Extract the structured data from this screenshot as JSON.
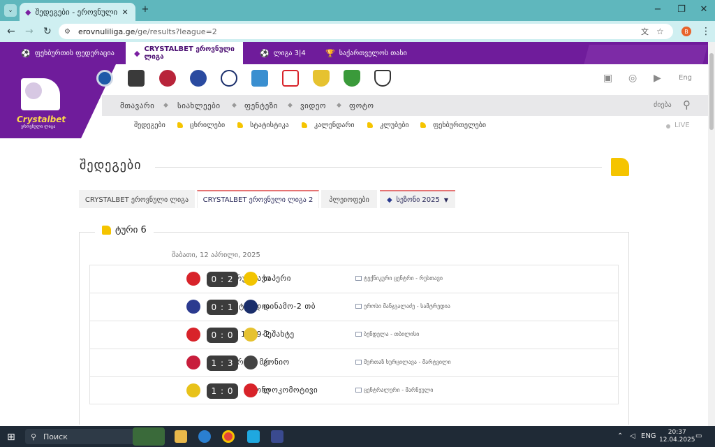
{
  "browser": {
    "tab_title": "შედეგები - ეროვნული ლიგა",
    "url_domain": "erovnuliliga.ge",
    "url_path": "/ge/results?league=2",
    "new_tab": "+",
    "profile_initial": "B",
    "icons": [
      "tab-dropdown-icon",
      "back-icon",
      "forward-icon",
      "reload-icon",
      "site-info-icon",
      "translate-icon",
      "star-icon",
      "menu-icon",
      "minimize-icon",
      "maximize-icon",
      "close-icon"
    ]
  },
  "site_tabs": [
    {
      "label": "ფეხბურთის ფედერაცია",
      "icon": "ball-icon"
    },
    {
      "label": "CRYSTALBET ეროვნული ლიგა",
      "icon": "league-icon",
      "active": true
    },
    {
      "label": "ლიგა 3|4",
      "icon": "ball-icon"
    },
    {
      "label": "საქართველოს თასი",
      "icon": "cup-icon"
    }
  ],
  "logo": {
    "brand": "Crystalbet",
    "sub": "ეროვნული ლიგა"
  },
  "header": {
    "language": "Eng",
    "search_label": "ძიება",
    "live_label": "LIVE"
  },
  "main_nav": [
    "მთავარი",
    "სიახლეები",
    "ფენტეზი",
    "ვიდეო",
    "ფოტო"
  ],
  "sub_nav": [
    "შედეგები",
    "ცხრილები",
    "სტატისტიკა",
    "კალენდარი",
    "კლუბები",
    "ფეხბურთელები"
  ],
  "page": {
    "title": "შედეგები"
  },
  "league_tabs": [
    {
      "label": "CRYSTALBET ეროვნული ლიგა"
    },
    {
      "label": "CRYSTALBET ეროვნული ლიგა 2",
      "active": true
    },
    {
      "label": "პლეიოფები"
    },
    {
      "label": "სეზონი 2025",
      "dropdown": true
    }
  ],
  "round": {
    "title": "ტური 6",
    "date": "შაბათი, 12 აპრილი, 2025",
    "matches": [
      {
        "home": "რუსთავი",
        "score": "0 : 2",
        "away": "საპერი",
        "venue": "ტექნიკური ცენტრი - რუსთავი",
        "home_color": "#d8232a",
        "away_color": "#f2c400"
      },
      {
        "home": "სამტრედია",
        "score": "0 : 1",
        "away": "დინამო-2 თბ",
        "venue": "ეროსი მანჯგალაძე - სამტრედია",
        "home_color": "#2b3a8f",
        "away_color": "#1a2e6b"
      },
      {
        "home": "იბერია 1999-2",
        "score": "0 : 0",
        "away": "მეშახტე",
        "venue": "ბენდელა - თბილისი",
        "home_color": "#d8232a",
        "away_color": "#e6c230"
      },
      {
        "home": "მერანი მრ",
        "score": "1 : 3",
        "away": "გონიო",
        "venue": "მურთაზ ხურცილავა - მარტვილი",
        "home_color": "#c81e3c",
        "away_color": "#444"
      },
      {
        "home": "სიონი",
        "score": "1 : 0",
        "away": "ლოკომოტივი",
        "venue": "ცენტრალური - მარნეული",
        "home_color": "#e8c21a",
        "away_color": "#d8232a"
      }
    ]
  },
  "taskbar": {
    "search_placeholder": "Поиск",
    "language": "ENG",
    "time": "20:37",
    "date": "12.04.2025"
  }
}
